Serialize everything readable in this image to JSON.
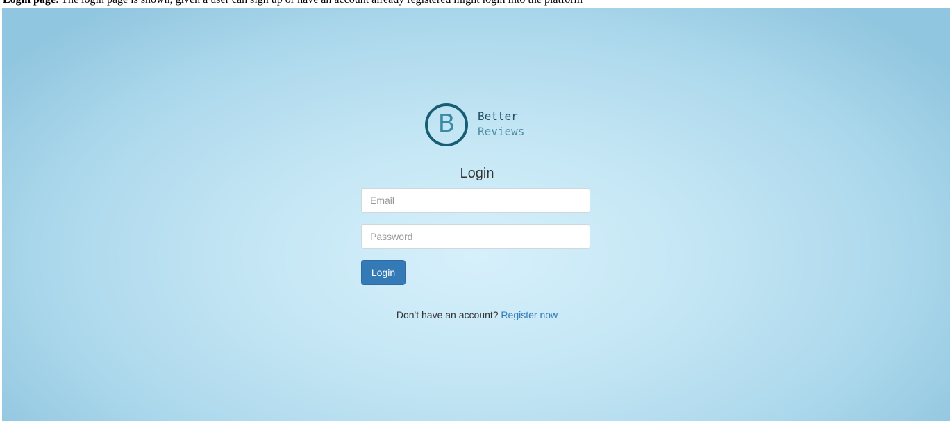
{
  "caption": {
    "label": "Login page",
    "text": "The login page is shown, given a user can sign up or have an account already registered might login into the platform"
  },
  "brand": {
    "logo_letter": "B",
    "name_line1": "Better",
    "name_line2": "Reviews"
  },
  "login_form": {
    "title": "Login",
    "email_placeholder": "Email",
    "password_placeholder": "Password",
    "submit_label": "Login"
  },
  "register": {
    "prompt": "Don't have an account?",
    "link_label": "Register now"
  },
  "colors": {
    "primary_button": "#337ab7",
    "logo_ring": "#175d74",
    "link": "#337ab7"
  }
}
